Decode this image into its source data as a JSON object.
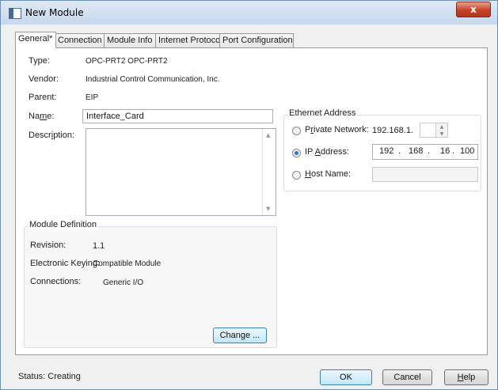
{
  "window": {
    "title": "New Module",
    "close_glyph": "x"
  },
  "tabs": [
    {
      "label": "General*"
    },
    {
      "label": "Connection"
    },
    {
      "label": "Module Info"
    },
    {
      "label": "Internet Protocol"
    },
    {
      "label": "Port Configuration"
    }
  ],
  "general": {
    "type_label": "Type:",
    "type_value": "OPC-PRT2 OPC-PRT2",
    "vendor_label": "Vendor:",
    "vendor_value": "Industrial Control Communication, Inc.",
    "parent_label": "Parent:",
    "parent_value": "EIP",
    "name_label_pre": "Na",
    "name_label_u": "m",
    "name_label_post": "e:",
    "name_value": "Interface_Card",
    "description_label_pre": "Descr",
    "description_label_u": "i",
    "description_label_post": "ption:",
    "description_value": ""
  },
  "ethernet": {
    "group_title": "Ethernet Address",
    "private_label_pre": "P",
    "private_label_u": "r",
    "private_label_post": "ivate Network:",
    "private_prefix": "192.168.1.",
    "private_value": "",
    "ip_label_pre": "IP ",
    "ip_label_u": "A",
    "ip_label_post": "ddress:",
    "ip_octets": [
      "192",
      "168",
      "16",
      "100"
    ],
    "ip_dots": [
      ".",
      ".",
      "."
    ],
    "host_label_pre": "",
    "host_label_u": "H",
    "host_label_post": "ost Name:",
    "host_value": "",
    "selected": "ip_address"
  },
  "module_definition": {
    "title": "Module Definition",
    "revision_label": "Revision:",
    "revision_value": "1.1",
    "keying_label": "Electronic Keying:",
    "keying_value": "Compatible Module",
    "connections_label": "Connections:",
    "connections_value": "Generic I/O",
    "change_button": "Change ..."
  },
  "status": {
    "text": "Status:  Creating"
  },
  "buttons": {
    "ok": "OK",
    "cancel": "Cancel",
    "help_u": "H",
    "help_post": "elp"
  }
}
